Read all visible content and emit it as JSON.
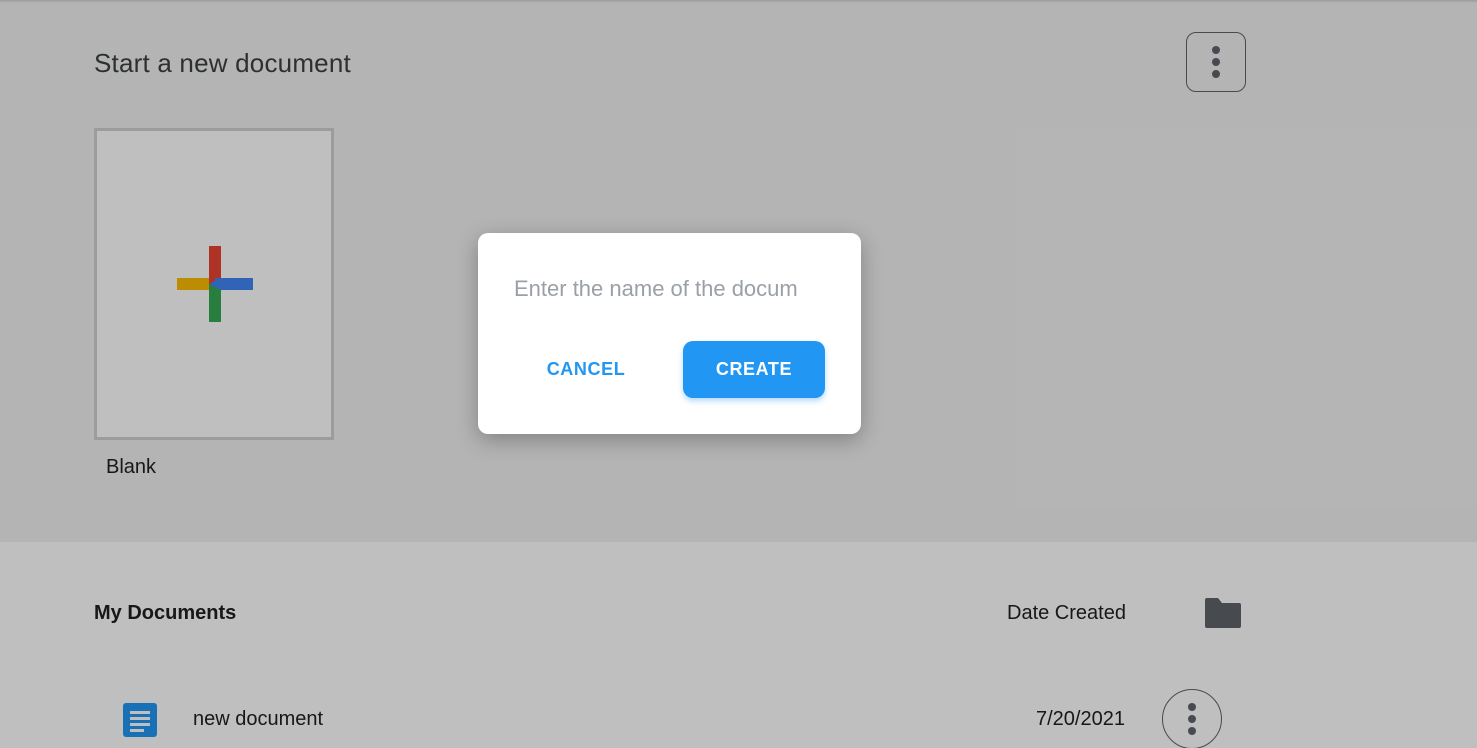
{
  "start_section": {
    "title": "Start a new document",
    "menu_icon": "more-vert-icon",
    "templates": [
      {
        "label": "Blank",
        "icon": "plus-icon"
      }
    ]
  },
  "documents_section": {
    "title": "My Documents",
    "sort_label": "Date Created",
    "folder_icon": "folder-icon",
    "rows": [
      {
        "name": "new document",
        "date": "7/20/2021",
        "icon": "doc-icon",
        "menu_icon": "more-vert-icon"
      }
    ]
  },
  "dialog": {
    "input_placeholder": "Enter the name of the docum",
    "input_value": "",
    "cancel_label": "CANCEL",
    "create_label": "CREATE"
  },
  "colors": {
    "accent": "#2196f3",
    "plus_red": "#ea4335",
    "plus_blue": "#4285f4",
    "plus_yellow": "#fbbc04",
    "plus_green": "#34a853"
  }
}
